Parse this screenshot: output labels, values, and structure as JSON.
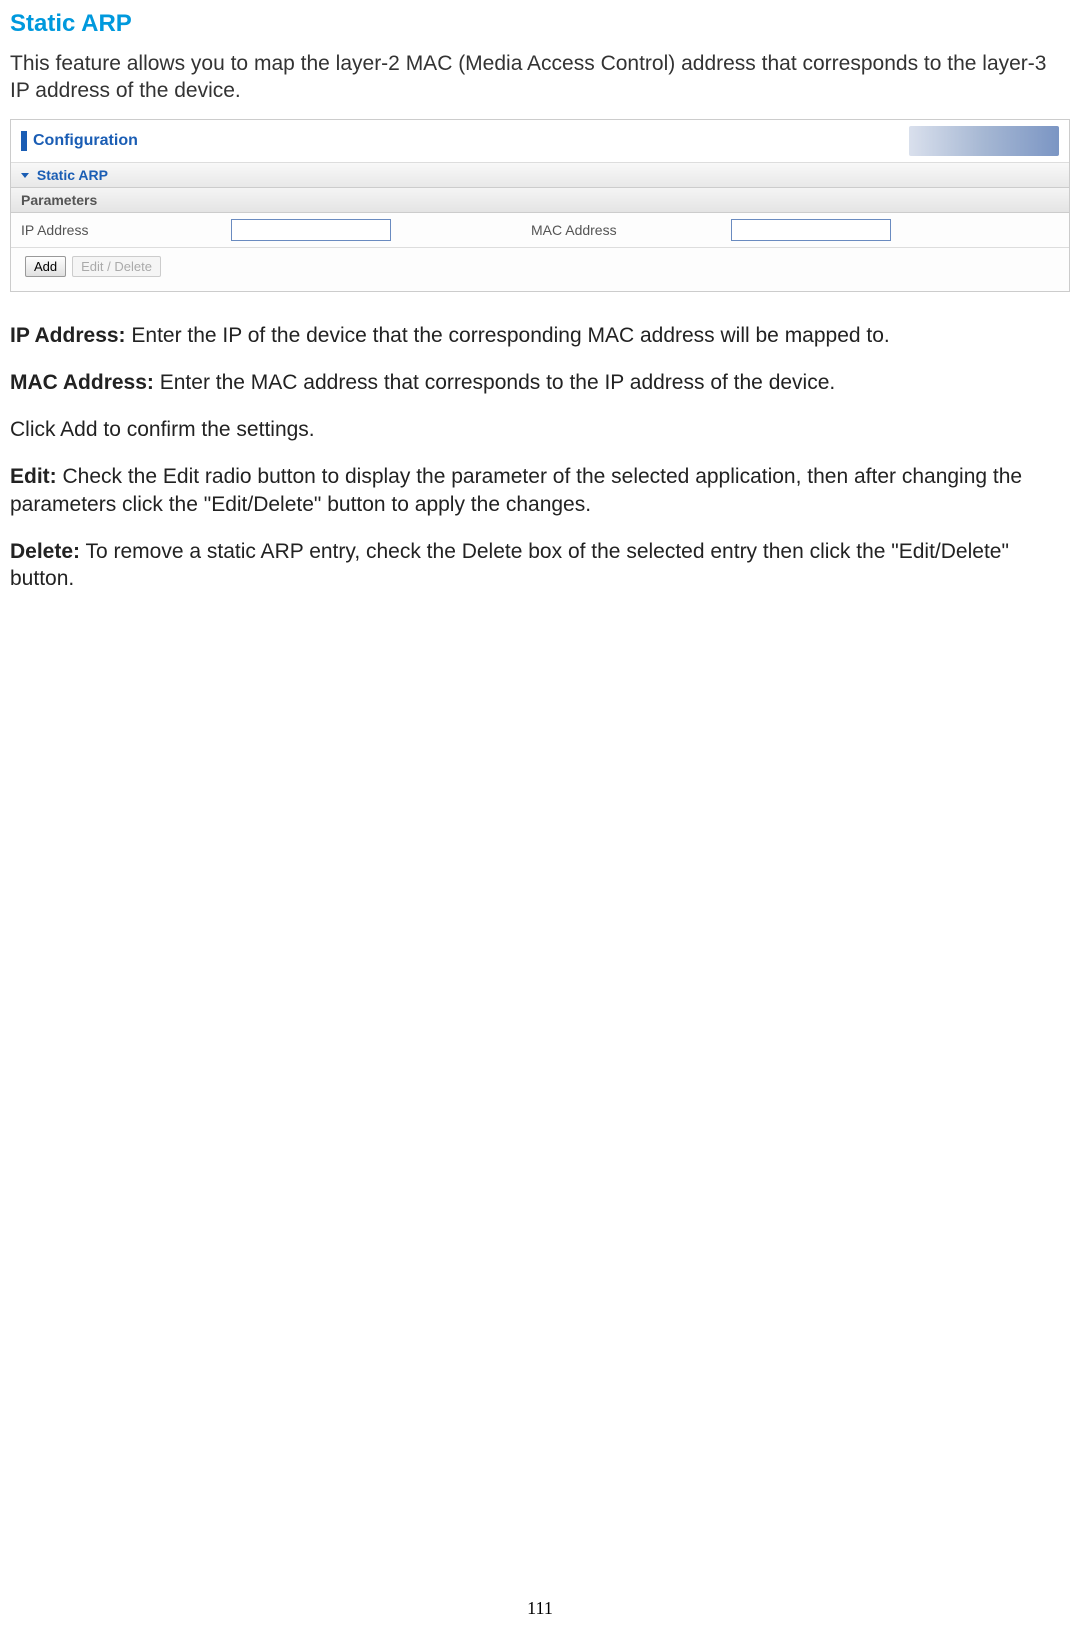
{
  "page": {
    "title": "Static ARP",
    "intro": "This feature allows you to map the layer-2 MAC (Media Access Control) address that corresponds to the layer-3 IP address of the device.",
    "page_number": "111"
  },
  "panel": {
    "header_title": "Configuration",
    "section_title": "Static ARP",
    "parameters_label": "Parameters",
    "fields": {
      "ip_label": "IP Address",
      "ip_value": "",
      "mac_label": "MAC Address",
      "mac_value": ""
    },
    "buttons": {
      "add": "Add",
      "edit_delete": "Edit / Delete"
    }
  },
  "descriptions": {
    "ip": {
      "label": "IP Address:",
      "text": " Enter the IP of the device that the corresponding MAC address will be mapped to."
    },
    "mac": {
      "label": "MAC Address:",
      "text": " Enter the MAC address that corresponds to the IP address of the device."
    },
    "add_note": "Click Add to confirm the settings.",
    "edit": {
      "label": "Edit:",
      "text": " Check the Edit radio button to display the parameter of the selected application, then after changing the parameters click the \"Edit/Delete\" button to apply the changes."
    },
    "delete": {
      "label": "Delete:",
      "text": " To remove a static ARP entry, check the Delete box of the selected entry then click the \"Edit/Delete\" button."
    }
  }
}
